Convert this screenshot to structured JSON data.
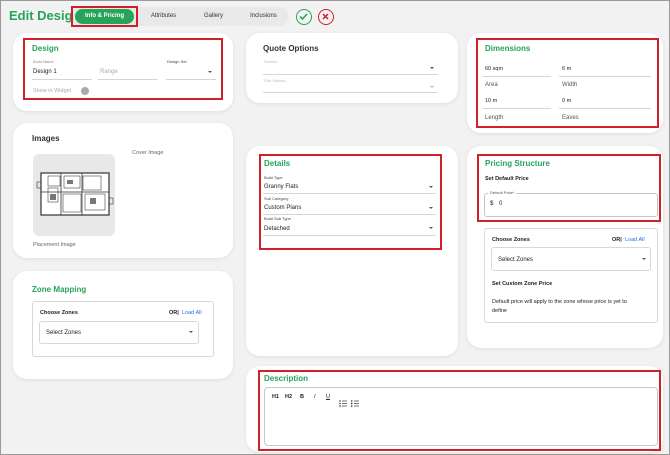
{
  "header": {
    "title": "Edit Design",
    "tabs": [
      {
        "label": "Info & Pricing"
      },
      {
        "label": "Attributes"
      },
      {
        "label": "Gallery"
      },
      {
        "label": "Inclusions"
      }
    ]
  },
  "design": {
    "title": "Design",
    "build_name_label": "Build Name",
    "build_name_value": "Design 1",
    "range_placeholder": "Range",
    "design_set_label": "Design Set",
    "show_in_widget_label": "Show in Widget"
  },
  "quote_options": {
    "title": "Quote Options",
    "section_label": "Section",
    "sub_section_label": "Sub Section"
  },
  "dimensions": {
    "title": "Dimensions",
    "area_value": "60 sqm",
    "area_label": "Area",
    "width_value": "6 m",
    "width_label": "Width",
    "length_value": "10 m",
    "length_label": "Length",
    "eaves_value": "0 m",
    "eaves_label": "Eaves"
  },
  "images": {
    "title": "Images",
    "cover_label": "Cover Image",
    "placement_label": "Placement Image"
  },
  "details": {
    "title": "Details",
    "build_type_label": "Build Type",
    "build_type_value": "Granny Flats",
    "sub_category_label": "Sub Category",
    "sub_category_value": "Custom Plans",
    "build_sub_type_label": "Build Sub Type",
    "build_sub_type_value": "Detached"
  },
  "pricing": {
    "title": "Pricing Structure",
    "set_default_label": "Set Default Price",
    "default_price_label": "Default Price*",
    "currency": "$",
    "default_price_value": "0",
    "choose_zones_label": "Choose Zones",
    "or_label": "OR|",
    "load_all_label": "Load All",
    "select_zones_placeholder": "Select Zones",
    "custom_zone_label": "Set Custom Zone Price",
    "note": "Default price will apply to the zone whose price is yet to define"
  },
  "zone_mapping": {
    "title": "Zone Mapping",
    "choose_zones_label": "Choose Zones",
    "or_label": "OR|",
    "load_all_label": "Load All",
    "select_zones_placeholder": "Select Zones"
  },
  "description": {
    "title": "Description",
    "toolbar": [
      "H1",
      "H2",
      "B",
      "I",
      "U"
    ]
  },
  "colors": {
    "accent_green": "#27a35a",
    "highlight_red": "#d0202a",
    "link_blue": "#2a6fdb"
  }
}
